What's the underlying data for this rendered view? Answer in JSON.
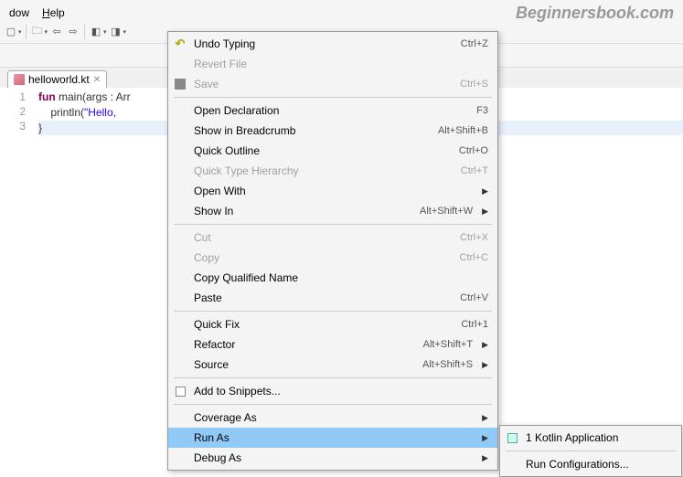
{
  "watermark": "Beginnersbook.com",
  "menubar": {
    "window": "dow",
    "help": "Help"
  },
  "tab": {
    "name": "helloworld.kt"
  },
  "code": {
    "line1a": "fun",
    "line1b": " main(args : Arr",
    "line2a": "    println(",
    "line2b": "\"Hello,",
    "line3": "}"
  },
  "gutter": [
    "1",
    "2",
    "3"
  ],
  "mainMenu": [
    {
      "label": "Undo Typing",
      "shortcut": "Ctrl+Z",
      "icon": "undo"
    },
    {
      "label": "Revert File",
      "disabled": true
    },
    {
      "label": "Save",
      "shortcut": "Ctrl+S",
      "disabled": true,
      "icon": "save"
    },
    "sep",
    {
      "label": "Open Declaration",
      "shortcut": "F3"
    },
    {
      "label": "Show in Breadcrumb",
      "shortcut": "Alt+Shift+B"
    },
    {
      "label": "Quick Outline",
      "shortcut": "Ctrl+O"
    },
    {
      "label": "Quick Type Hierarchy",
      "shortcut": "Ctrl+T",
      "disabled": true
    },
    {
      "label": "Open With",
      "submenu": true
    },
    {
      "label": "Show In",
      "shortcut": "Alt+Shift+W",
      "submenu": true
    },
    "sep",
    {
      "label": "Cut",
      "shortcut": "Ctrl+X",
      "disabled": true
    },
    {
      "label": "Copy",
      "shortcut": "Ctrl+C",
      "disabled": true
    },
    {
      "label": "Copy Qualified Name"
    },
    {
      "label": "Paste",
      "shortcut": "Ctrl+V"
    },
    "sep",
    {
      "label": "Quick Fix",
      "shortcut": "Ctrl+1"
    },
    {
      "label": "Refactor",
      "shortcut": "Alt+Shift+T",
      "submenu": true
    },
    {
      "label": "Source",
      "shortcut": "Alt+Shift+S",
      "submenu": true
    },
    "sep",
    {
      "label": "Add to Snippets...",
      "icon": "snippet"
    },
    "sep",
    {
      "label": "Coverage As",
      "submenu": true
    },
    {
      "label": "Run As",
      "submenu": true,
      "highlighted": true
    },
    {
      "label": "Debug As",
      "submenu": true
    }
  ],
  "subMenu": [
    {
      "label": "1 Kotlin Application",
      "icon": "kapp"
    },
    "sep",
    {
      "label": "Run Configurations..."
    }
  ]
}
